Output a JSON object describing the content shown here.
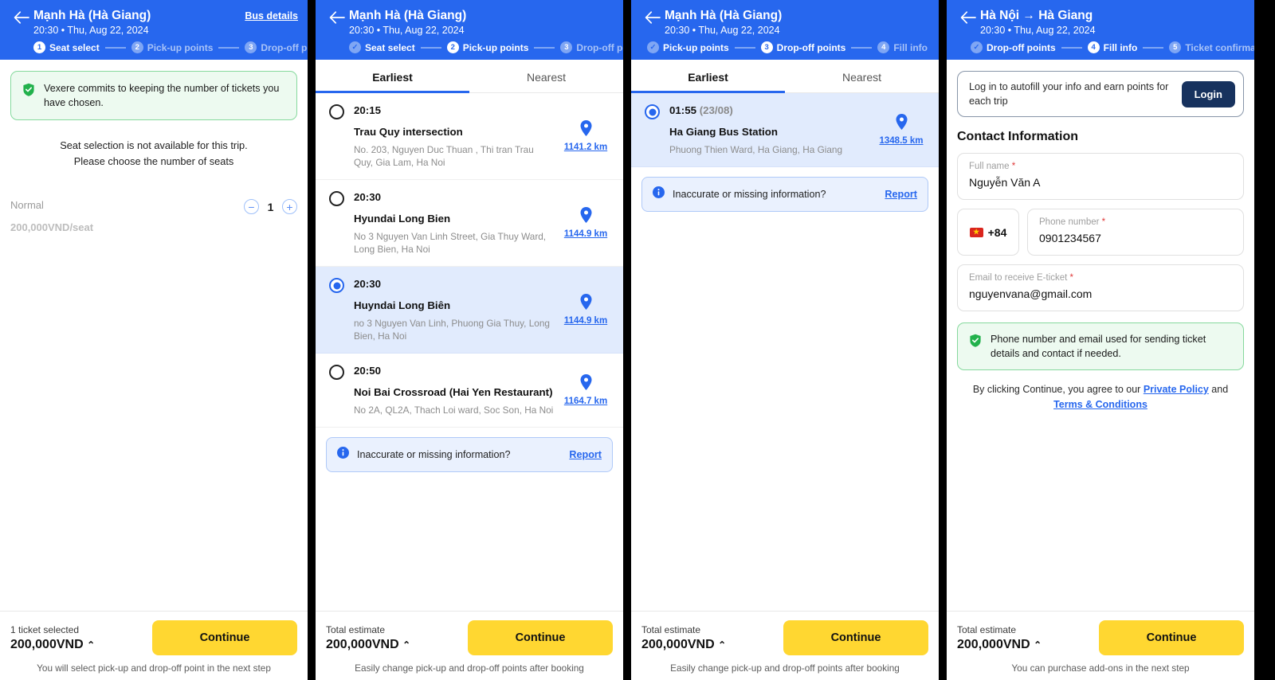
{
  "panels": [
    {
      "header": {
        "title": "Mạnh Hà (Hà Giang)",
        "subtitle": "20:30 • Thu, Aug 22, 2024",
        "action_label": "Bus details",
        "steps": [
          {
            "num": "1",
            "label": "Seat select",
            "state": "active"
          },
          {
            "num": "2",
            "label": "Pick-up points",
            "state": "todo"
          },
          {
            "num": "3",
            "label": "Drop-off points",
            "state": "todo"
          }
        ]
      },
      "notice": "Vexere commits to keeping the number of tickets you have chosen.",
      "seat_message_line1": "Seat selection is not available for this trip.",
      "seat_message_line2": "Please choose the number of seats",
      "seat_type": "Normal",
      "seat_price": "200,000VND/seat",
      "minus_label": "−",
      "plus_label": "+",
      "seat_count": "1",
      "footer": {
        "label": "1 ticket selected",
        "price": "200,000VND",
        "caret": "⌃",
        "button": "Continue",
        "note": "You will select pick-up and drop-off point in the next step"
      }
    },
    {
      "header": {
        "title": "Mạnh Hà (Hà Giang)",
        "subtitle": "20:30 • Thu, Aug 22, 2024",
        "steps": [
          {
            "num": "✓",
            "label": "Seat select",
            "state": "done"
          },
          {
            "num": "2",
            "label": "Pick-up points",
            "state": "active"
          },
          {
            "num": "3",
            "label": "Drop-off points",
            "state": "todo"
          }
        ]
      },
      "tabs": [
        {
          "label": "Earliest",
          "active": true
        },
        {
          "label": "Nearest",
          "active": false
        }
      ],
      "points": [
        {
          "time": "20:15",
          "date": "",
          "name": "Trau Quy intersection",
          "address": "No. 203, Nguyen Duc Thuan , Thi tran Trau Quy, Gia Lam, Ha Noi",
          "distance": "1141.2 km",
          "selected": false
        },
        {
          "time": "20:30",
          "date": "",
          "name": "Hyundai Long Bien",
          "address": "No 3 Nguyen Van Linh Street, Gia Thuy Ward, Long Bien, Ha Noi",
          "distance": "1144.9 km",
          "selected": false
        },
        {
          "time": "20:30",
          "date": "",
          "name": "Huyndai Long Biên",
          "address": "no 3 Nguyen Van Linh, Phuong Gia Thuy, Long Bien, Ha Noi",
          "distance": "1144.9 km",
          "selected": true
        },
        {
          "time": "20:50",
          "date": "",
          "name": "Noi Bai Crossroad (Hai Yen Restaurant)",
          "address": "No 2A, QL2A, Thach Loi ward, Soc Son, Ha Noi",
          "distance": "1164.7 km",
          "selected": false
        }
      ],
      "report": {
        "text": "Inaccurate or missing information?",
        "link": "Report"
      },
      "footer": {
        "label": "Total estimate",
        "price": "200,000VND",
        "caret": "⌃",
        "button": "Continue",
        "note": "Easily change pick-up and drop-off points after booking"
      }
    },
    {
      "header": {
        "title": "Mạnh Hà (Hà Giang)",
        "subtitle": "20:30 • Thu, Aug 22, 2024",
        "steps": [
          {
            "num": "✓",
            "label": "Pick-up points",
            "state": "done"
          },
          {
            "num": "3",
            "label": "Drop-off points",
            "state": "active"
          },
          {
            "num": "4",
            "label": "Fill info",
            "state": "todo"
          }
        ]
      },
      "tabs": [
        {
          "label": "Earliest",
          "active": true
        },
        {
          "label": "Nearest",
          "active": false
        }
      ],
      "points": [
        {
          "time": "01:55",
          "date": "(23/08)",
          "name": "Ha Giang Bus Station",
          "address": "Phuong Thien Ward, Ha Giang, Ha Giang",
          "distance": "1348.5 km",
          "selected": true
        }
      ],
      "report": {
        "text": "Inaccurate or missing information?",
        "link": "Report"
      },
      "footer": {
        "label": "Total estimate",
        "price": "200,000VND",
        "caret": "⌃",
        "button": "Continue",
        "note": "Easily change pick-up and drop-off points after booking"
      }
    },
    {
      "header": {
        "title": "Hà Nội → Hà Giang",
        "subtitle": "20:30 • Thu, Aug 22, 2024",
        "steps": [
          {
            "num": "✓",
            "label": "Drop-off points",
            "state": "done"
          },
          {
            "num": "4",
            "label": "Fill info",
            "state": "active"
          },
          {
            "num": "5",
            "label": "Ticket confirmation",
            "state": "todo"
          }
        ]
      },
      "login_prompt": "Log in to autofill your info and earn points for each trip",
      "login_button": "Login",
      "section_title": "Contact Information",
      "fields": {
        "full_name_label": "Full name",
        "full_name_value": "Nguyễn Văn A",
        "country_code": "+84",
        "phone_label": "Phone number",
        "phone_value": "0901234567",
        "email_label": "Email to receive E-ticket",
        "email_value": "nguyenvana@gmail.com"
      },
      "green_note": "Phone number and email used for sending ticket details and contact if needed.",
      "terms": {
        "prefix": "By clicking Continue, you agree to our ",
        "link1": "Private Policy",
        "middle": " and ",
        "link2": "Terms & Conditions"
      },
      "footer": {
        "label": "Total estimate",
        "price": "200,000VND",
        "caret": "⌃",
        "button": "Continue",
        "note": "You can purchase add-ons in the next step"
      }
    }
  ],
  "colors": {
    "brand_blue": "#2767EE",
    "accent_yellow": "#FFD731",
    "selected_row": "#E1EBFD",
    "success_green": "#EDFAF0",
    "login_navy": "#17325E"
  }
}
